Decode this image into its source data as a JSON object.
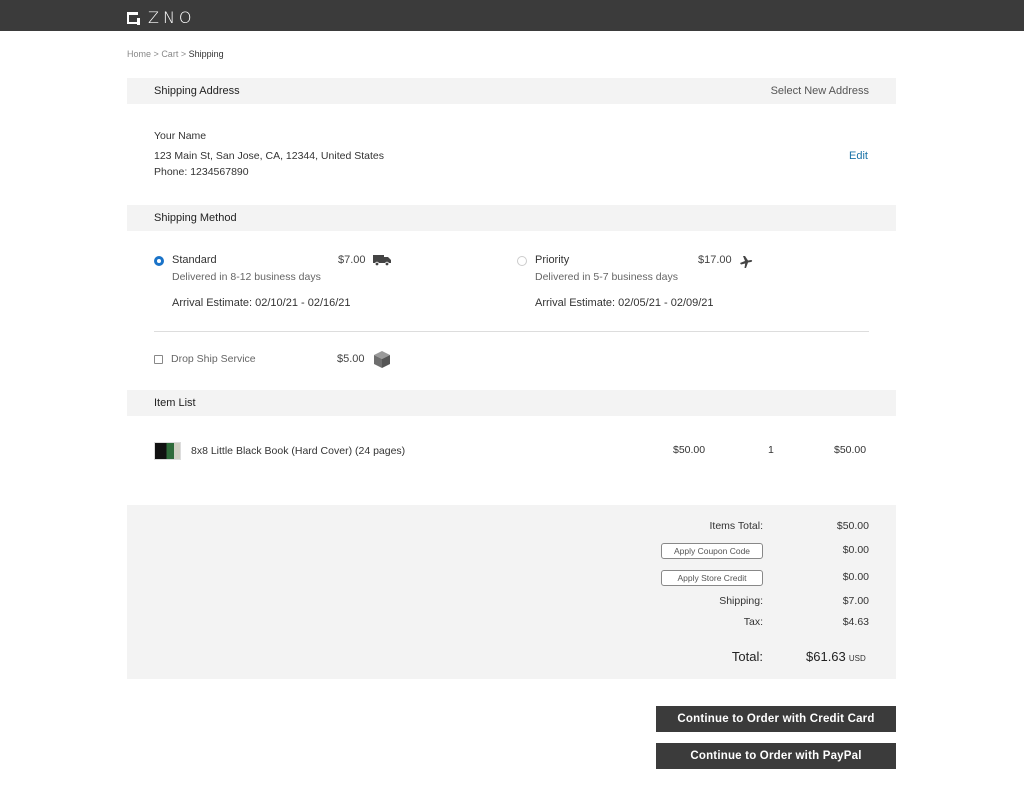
{
  "brand": {
    "name": "ZNO"
  },
  "breadcrumb": {
    "home": "Home",
    "sep1": ">",
    "cart": "Cart",
    "sep2": ">",
    "current": "Shipping"
  },
  "shipping_address": {
    "title": "Shipping Address",
    "select_new": "Select New Address",
    "name": "Your Name",
    "street": "123 Main St, San Jose, CA, 12344, United States",
    "phone": "Phone: 1234567890",
    "edit": "Edit"
  },
  "shipping_method": {
    "title": "Shipping Method",
    "options": [
      {
        "name": "Standard",
        "price": "$7.00",
        "delivery": "Delivered in 8-12 business days",
        "arrival": "Arrival Estimate: 02/10/21 - 02/16/21",
        "selected": true,
        "icon": "truck-icon"
      },
      {
        "name": "Priority",
        "price": "$17.00",
        "delivery": "Delivered in 5-7 business days",
        "arrival": "Arrival Estimate: 02/05/21 - 02/09/21",
        "selected": false,
        "icon": "airplane-icon"
      }
    ],
    "drop_ship": {
      "label": "Drop Ship Service",
      "price": "$5.00",
      "checked": false,
      "icon": "box-icon"
    }
  },
  "item_list": {
    "title": "Item List",
    "items": [
      {
        "name": "8x8 Little Black Book (Hard Cover) (24 pages)",
        "unit_price": "$50.00",
        "qty": "1",
        "total": "$50.00"
      }
    ]
  },
  "summary": {
    "items_total_label": "Items Total:",
    "items_total": "$50.00",
    "coupon_label": "Apply Coupon Code",
    "coupon_value": "$0.00",
    "store_credit_label": "Apply Store Credit",
    "store_credit_value": "$0.00",
    "shipping_label": "Shipping:",
    "shipping": "$7.00",
    "tax_label": "Tax:",
    "tax": "$4.63",
    "total_label": "Total:",
    "total": "$61.63",
    "currency": "USD"
  },
  "actions": {
    "credit_card": "Continue to Order with Credit Card",
    "paypal": "Continue to Order with PayPal"
  },
  "colors": {
    "topbar": "#3b3b3b",
    "accent": "#1a73c8",
    "panel": "#f3f3f3"
  }
}
